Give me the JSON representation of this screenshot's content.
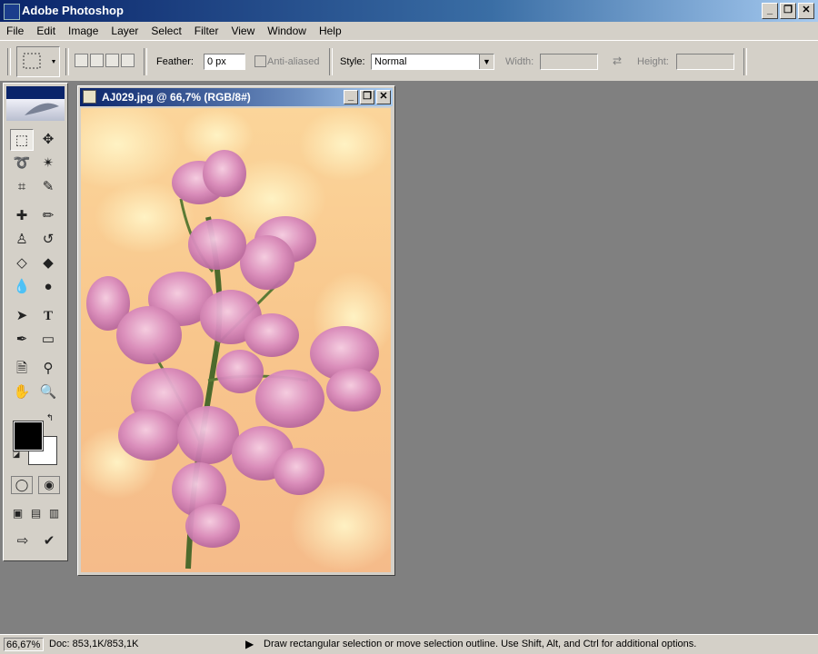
{
  "app": {
    "title": "Adobe Photoshop",
    "icon": "photoshop-icon"
  },
  "window_buttons": [
    "_",
    "❐",
    "✕"
  ],
  "menu": [
    "File",
    "Edit",
    "Image",
    "Layer",
    "Select",
    "Filter",
    "View",
    "Window",
    "Help"
  ],
  "options": {
    "feather_label": "Feather:",
    "feather_value": "0 px",
    "anti_aliased_label": "Anti-aliased",
    "style_label": "Style:",
    "style_value": "Normal",
    "width_label": "Width:",
    "height_label": "Height:"
  },
  "document": {
    "title": "AJ029.jpg @ 66,7% (RGB/8#)",
    "buttons": [
      "_",
      "❐",
      "✕"
    ]
  },
  "status": {
    "zoom": "66,67%",
    "doc": "Doc: 853,1K/853,1K",
    "hint": "Draw rectangular selection or move selection outline.  Use Shift, Alt, and Ctrl for additional options."
  },
  "colors": {
    "foreground": "#000000",
    "background": "#ffffff",
    "workspace": "#808080",
    "title_gradient_start": "#0a246a"
  },
  "tools": [
    "marquee-icon",
    "move-icon",
    "lasso-icon",
    "magic-wand-icon",
    "crop-icon",
    "slice-icon",
    "healing-brush-icon",
    "brush-icon",
    "clone-stamp-icon",
    "history-brush-icon",
    "eraser-icon",
    "paint-bucket-icon",
    "blur-icon",
    "dodge-icon",
    "path-select-icon",
    "type-icon",
    "pen-icon",
    "shape-icon",
    "notes-icon",
    "eyedropper-icon",
    "hand-icon",
    "zoom-icon"
  ]
}
